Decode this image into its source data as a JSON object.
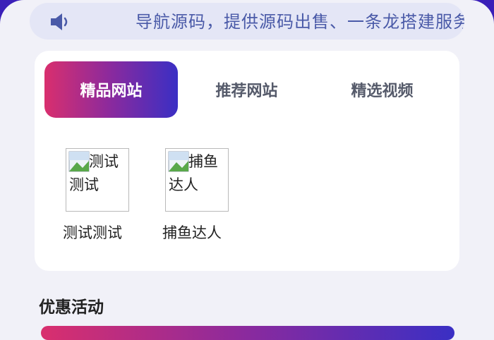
{
  "notice": {
    "text": "导航源码，提供源码出售、一条龙搭建服务"
  },
  "tabs": [
    {
      "label": "精品网站",
      "active": true
    },
    {
      "label": "推荐网站",
      "active": false
    },
    {
      "label": "精选视频",
      "active": false
    }
  ],
  "sites": [
    {
      "thumb_alt": "测试测试",
      "name": "测试测试"
    },
    {
      "thumb_alt": "捕鱼达人",
      "name": "捕鱼达人"
    }
  ],
  "promo": {
    "section_title": "优惠活动"
  },
  "colors": {
    "accent_gradient": [
      "#d92f6e",
      "#8a2a9e",
      "#3a2fc4"
    ],
    "notice_text": "#4a5aa8",
    "header_bg": "#3a1fb8"
  },
  "icons": {
    "notice": "speaker-icon",
    "thumb": "broken-image-icon"
  }
}
